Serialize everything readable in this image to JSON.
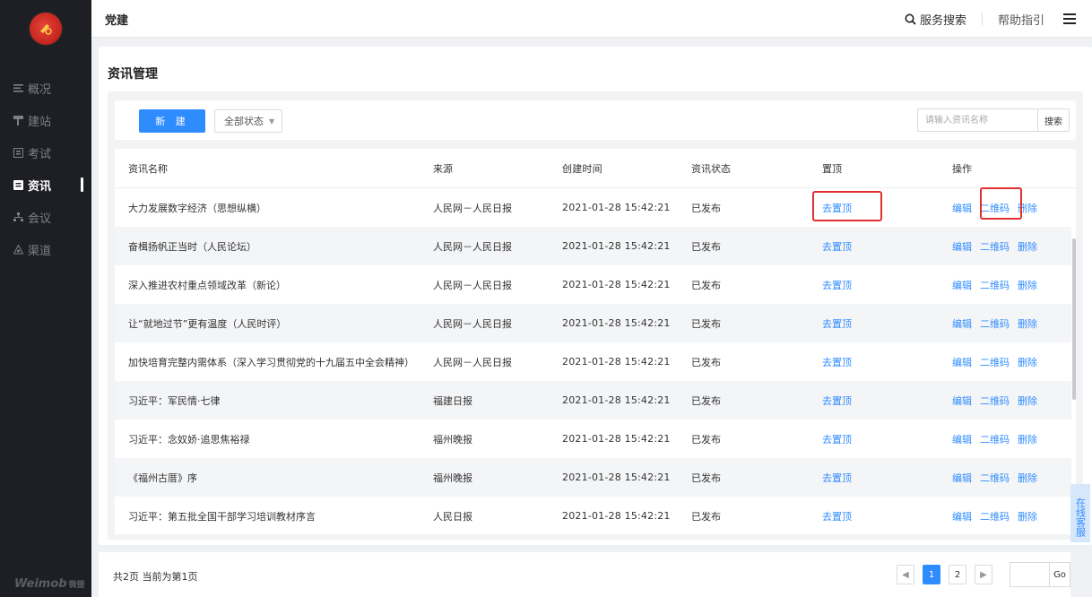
{
  "sidebar": {
    "items": [
      {
        "icon": "list-icon",
        "label": "概况"
      },
      {
        "icon": "flag-icon",
        "label": "建站"
      },
      {
        "icon": "exam-icon",
        "label": "考试"
      },
      {
        "icon": "news-icon",
        "label": "资讯",
        "active": true
      },
      {
        "icon": "org-icon",
        "label": "会议"
      },
      {
        "icon": "channel-icon",
        "label": "渠道"
      }
    ],
    "brand": "Weimob",
    "brand_cn": "微盟"
  },
  "header": {
    "title": "党建",
    "search_label": "服务搜索",
    "help_label": "帮助指引"
  },
  "main": {
    "title": "资讯管理",
    "new_button": "新 建",
    "status_select": "全部状态",
    "search_placeholder": "请输入资讯名称",
    "search_button": "搜索",
    "columns": [
      "资讯名称",
      "来源",
      "创建时间",
      "资讯状态",
      "置顶",
      "操作"
    ],
    "rows": [
      {
        "name": "大力发展数字经济（思想纵横）",
        "source": "人民网－人民日报",
        "created": "2021-01-28 15:42:21",
        "status": "已发布",
        "top": "去置顶"
      },
      {
        "name": "奋楫扬帆正当时（人民论坛）",
        "source": "人民网－人民日报",
        "created": "2021-01-28 15:42:21",
        "status": "已发布",
        "top": "去置顶"
      },
      {
        "name": "深入推进农村重点领域改革（新论）",
        "source": "人民网－人民日报",
        "created": "2021-01-28 15:42:21",
        "status": "已发布",
        "top": "去置顶"
      },
      {
        "name": "让“就地过节”更有温度（人民时评）",
        "source": "人民网－人民日报",
        "created": "2021-01-28 15:42:21",
        "status": "已发布",
        "top": "去置顶"
      },
      {
        "name": "加快培育完整内需体系（深入学习贯彻党的十九届五中全会精神）",
        "source": "人民网－人民日报",
        "created": "2021-01-28 15:42:21",
        "status": "已发布",
        "top": "去置顶"
      },
      {
        "name": "习近平：军民情·七律",
        "source": "福建日报",
        "created": "2021-01-28 15:42:21",
        "status": "已发布",
        "top": "去置顶"
      },
      {
        "name": "习近平：念奴娇·追思焦裕禄",
        "source": "福州晚报",
        "created": "2021-01-28 15:42:21",
        "status": "已发布",
        "top": "去置顶"
      },
      {
        "name": "《福州古厝》序",
        "source": "福州晚报",
        "created": "2021-01-28 15:42:21",
        "status": "已发布",
        "top": "去置顶"
      },
      {
        "name": "习近平：第五批全国干部学习培训教材序言",
        "source": "人民日报",
        "created": "2021-01-28 15:42:21",
        "status": "已发布",
        "top": "去置顶"
      }
    ],
    "ops": {
      "edit": "编辑",
      "qrcode": "二维码",
      "delete": "删除"
    }
  },
  "service_label": "在线客服",
  "footer": {
    "page_info": "共2页 当前为第1页",
    "pages": [
      "1",
      "2"
    ],
    "prev": "◀",
    "next": "▶",
    "go_button": "Go"
  },
  "colors": {
    "accent": "#2f8cff",
    "sidebar_bg": "#1e1f24",
    "highlight": "#e02f2f"
  }
}
